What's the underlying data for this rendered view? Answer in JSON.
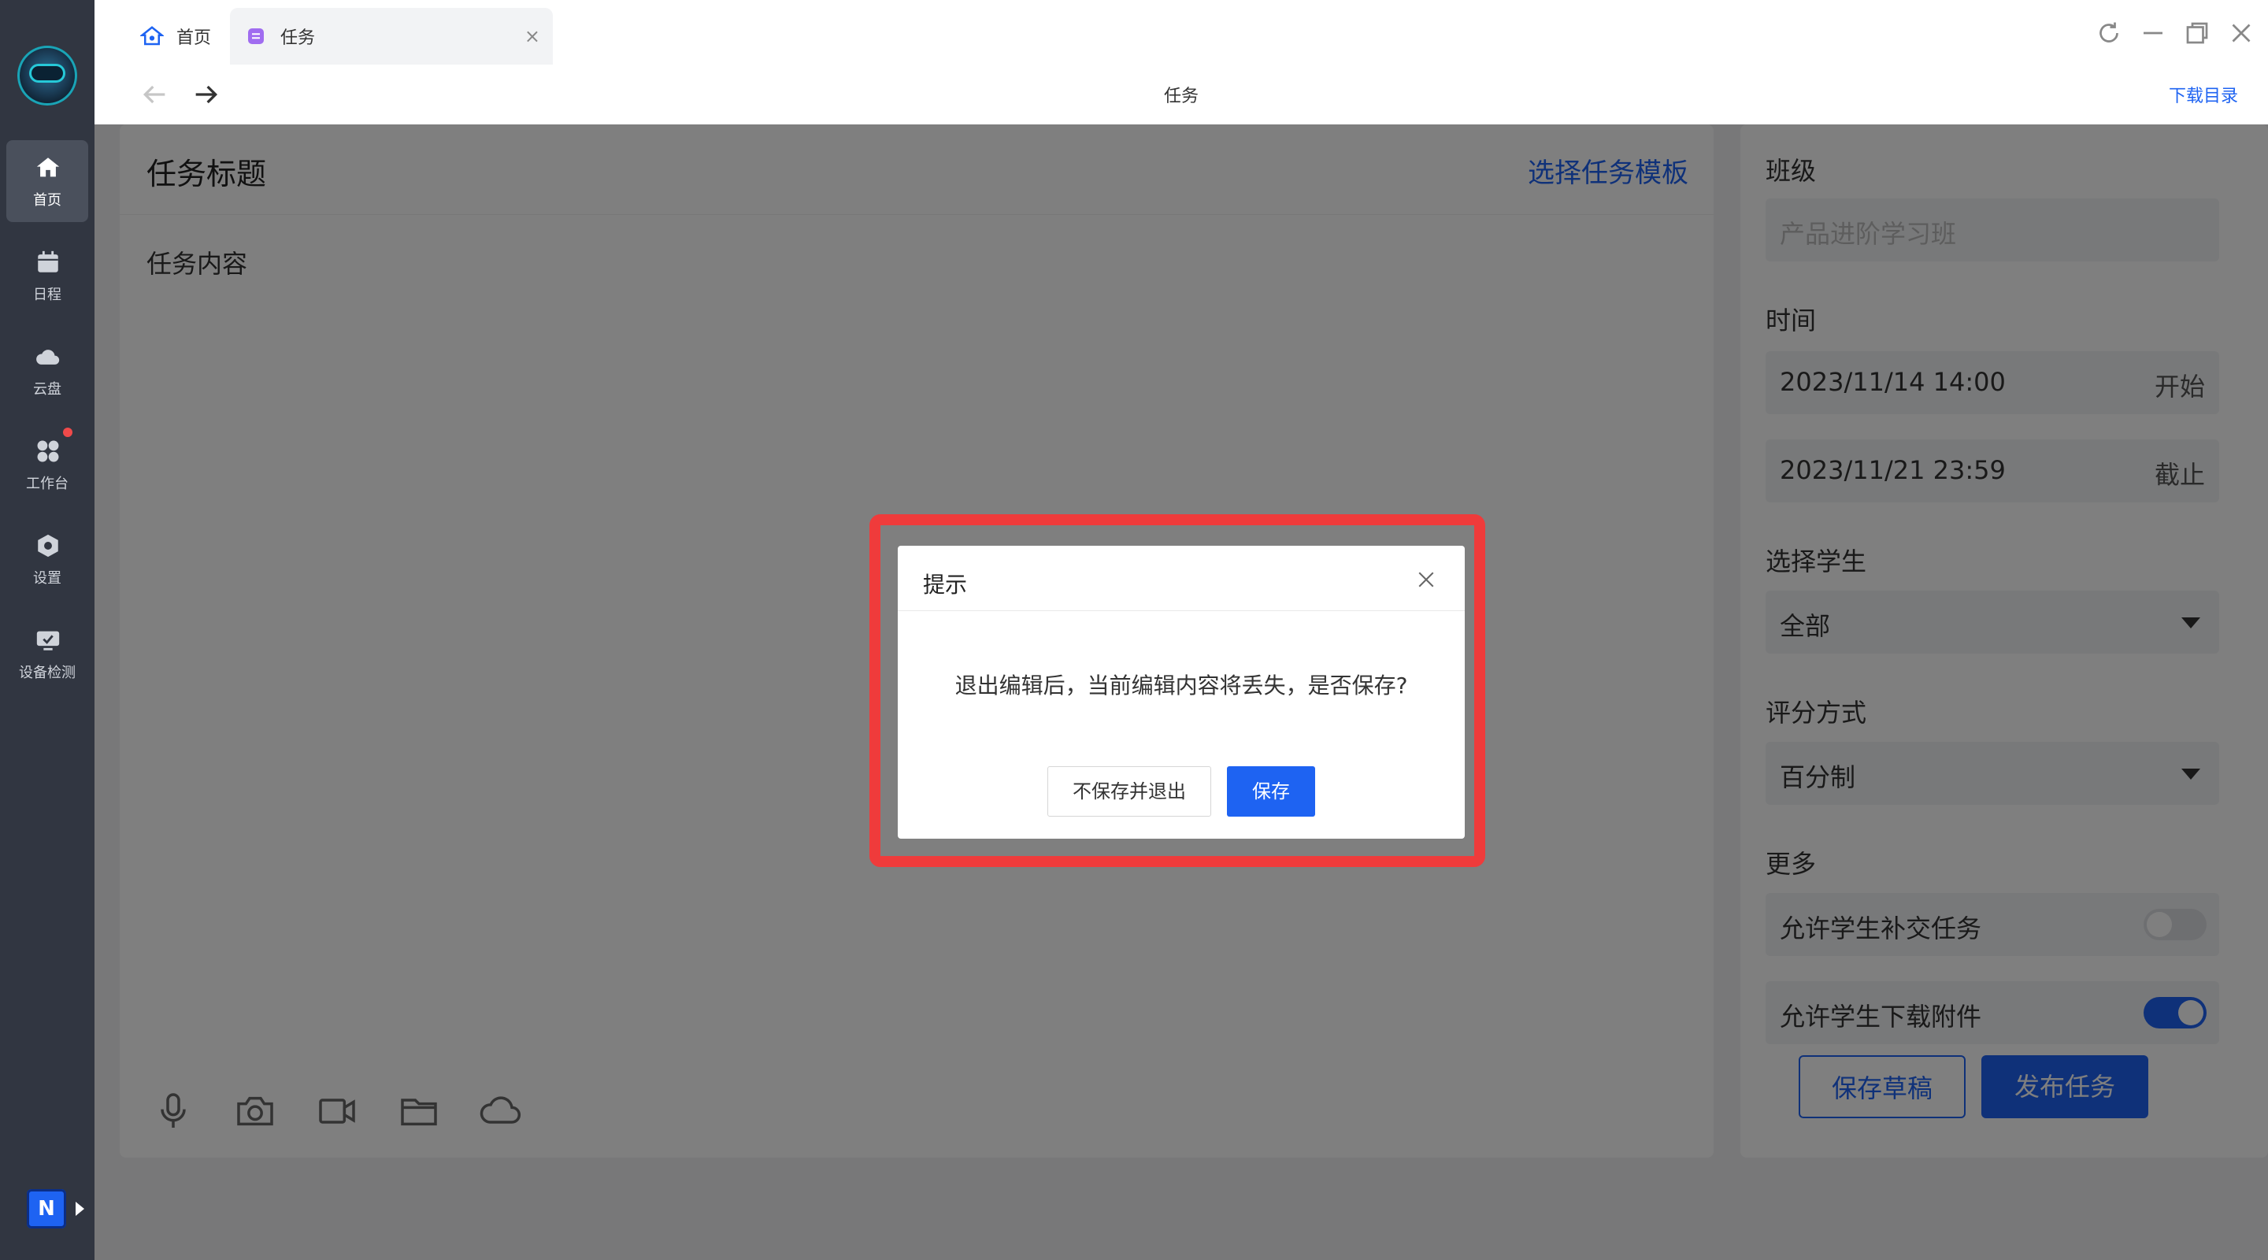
{
  "sidebar": {
    "items": [
      {
        "label": "首页",
        "icon": "home-icon"
      },
      {
        "label": "日程",
        "icon": "calendar-icon"
      },
      {
        "label": "云盘",
        "icon": "cloud-icon"
      },
      {
        "label": "工作台",
        "icon": "apps-icon"
      },
      {
        "label": "设置",
        "icon": "gear-icon"
      },
      {
        "label": "设备检测",
        "icon": "device-check-icon"
      }
    ],
    "badge": "N"
  },
  "tabs": [
    {
      "label": "首页",
      "icon": "home-icon"
    },
    {
      "label": "任务",
      "icon": "task-icon",
      "close": "×"
    }
  ],
  "toolbar": {
    "title": "任务",
    "download": "下载目录"
  },
  "editor": {
    "title": "任务标题",
    "template_link": "选择任务模板",
    "content_placeholder": "任务内容",
    "tools": [
      "microphone-icon",
      "camera-icon",
      "video-icon",
      "folder-icon",
      "cloud-icon"
    ]
  },
  "panel": {
    "class_label": "班级",
    "class_placeholder": "产品进阶学习班",
    "time_label": "时间",
    "start_time": "2023/11/14 14:00",
    "start_suffix": "开始",
    "end_time": "2023/11/21 23:59",
    "end_suffix": "截止",
    "students_label": "选择学生",
    "students_value": "全部",
    "grading_label": "评分方式",
    "grading_value": "百分制",
    "more_label": "更多",
    "late_submit_label": "允许学生补交任务",
    "late_submit": false,
    "download_label": "允许学生下载附件",
    "download_allowed": true
  },
  "footer": {
    "save_draft": "保存草稿",
    "publish": "发布任务"
  },
  "dialog": {
    "title": "提示",
    "message": "退出编辑后，当前编辑内容将丢失，是否保存?",
    "no_save_label": "不保存并退出",
    "save_label": "保存"
  },
  "colors": {
    "accent": "#1e63f2",
    "sidebar": "#313641",
    "highlight": "#ef3b3b"
  }
}
